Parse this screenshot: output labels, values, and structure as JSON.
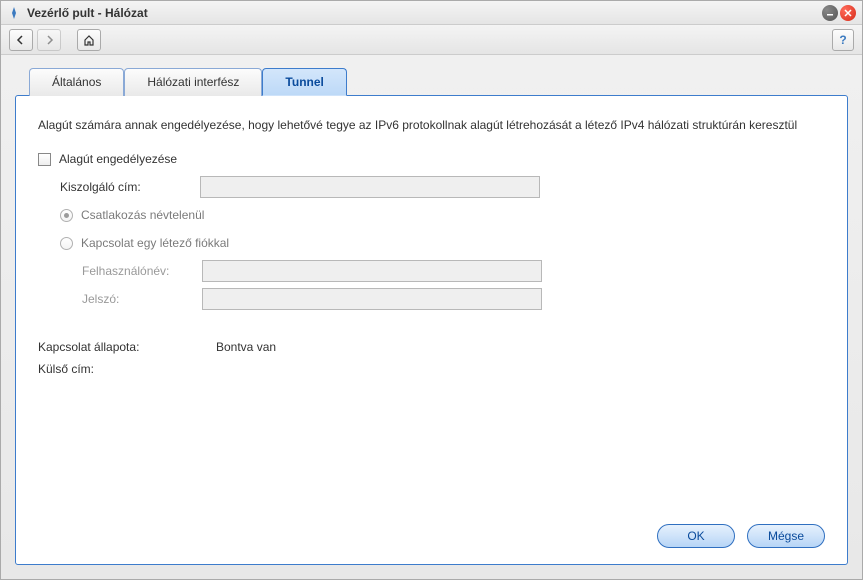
{
  "window": {
    "title": "Vezérlő pult - Hálózat"
  },
  "tabs": [
    {
      "label": "Általános"
    },
    {
      "label": "Hálózati interfész"
    },
    {
      "label": "Tunnel"
    }
  ],
  "main": {
    "description": "Alagút számára annak engedélyezése, hogy lehetővé tegye az IPv6 protokollnak alagút létrehozását a létező IPv4 hálózati struktúrán keresztül",
    "enable_tunnel_label": "Alagút engedélyezése",
    "server_address_label": "Kiszolgáló cím:",
    "server_address_value": "",
    "connect_anon_label": "Csatlakozás névtelenül",
    "connect_account_label": "Kapcsolat egy létező fiókkal",
    "username_label": "Felhasználónév:",
    "username_value": "",
    "password_label": "Jelszó:",
    "password_value": "",
    "status_label": "Kapcsolat állapota:",
    "status_value": "Bontva van",
    "external_label": "Külső cím:",
    "external_value": ""
  },
  "buttons": {
    "ok": "OK",
    "cancel": "Mégse"
  }
}
